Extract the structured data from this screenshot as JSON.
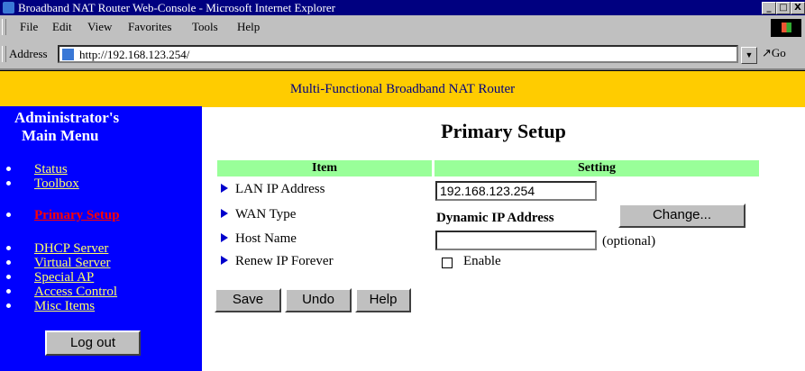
{
  "window": {
    "title": "Broadband NAT Router Web-Console - Microsoft Internet Explorer",
    "min": "_",
    "max": "□",
    "close": "X"
  },
  "menubar": [
    "File",
    "Edit",
    "View",
    "Favorites",
    "Tools",
    "Help"
  ],
  "address": {
    "label": "Address",
    "url": "http://192.168.123.254/",
    "go": "Go"
  },
  "banner": "Multi-Functional Broadband NAT Router",
  "sidebar": {
    "title_line1": "Administrator's",
    "title_line2": "Main Menu",
    "items": [
      {
        "label": "Status"
      },
      {
        "label": "Toolbox"
      },
      {
        "label": "Primary Setup",
        "active": true
      },
      {
        "label": "DHCP Server"
      },
      {
        "label": "Virtual Server"
      },
      {
        "label": "Special AP"
      },
      {
        "label": "Access Control"
      },
      {
        "label": "Misc Items"
      }
    ],
    "logout": "Log out"
  },
  "main": {
    "title": "Primary Setup",
    "headers": {
      "item": "Item",
      "setting": "Setting"
    },
    "rows": {
      "lan_ip_label": "LAN IP Address",
      "lan_ip_value": "192.168.123.254",
      "wan_type_label": "WAN Type",
      "wan_type_value": "Dynamic IP Address",
      "wan_change": "Change...",
      "host_name_label": "Host Name",
      "host_name_value": "",
      "host_name_hint": "(optional)",
      "renew_label": "Renew IP Forever",
      "renew_option": "Enable"
    },
    "buttons": {
      "save": "Save",
      "undo": "Undo",
      "help": "Help"
    }
  },
  "colors": {
    "titlebar": "#000080",
    "banner": "#ffcc00",
    "sidebar": "#0000ff",
    "table_header": "#99ff99",
    "active_link": "#ff0000",
    "link": "#ffff66"
  }
}
